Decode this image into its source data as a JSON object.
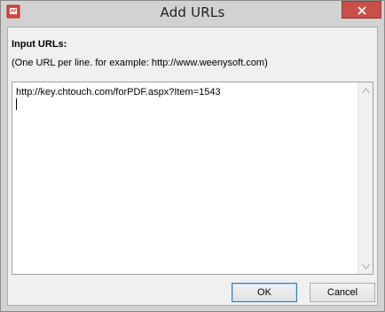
{
  "window": {
    "title": "Add URLs"
  },
  "form": {
    "heading": "Input URLs:",
    "hint": "(One URL per line. for example: http://www.weenysoft.com)",
    "urls_value": "http://key.chtouch.com/forPDF.aspx?Item=1543"
  },
  "buttons": {
    "ok_label": "OK",
    "cancel_label": "Cancel"
  },
  "colors": {
    "close_button": "#c7504a",
    "default_button_border": "#3c7fb1"
  },
  "icons": {
    "app": "app-icon",
    "close": "close-icon",
    "scroll_up": "scroll-up-arrow-icon",
    "scroll_down": "scroll-down-arrow-icon"
  }
}
